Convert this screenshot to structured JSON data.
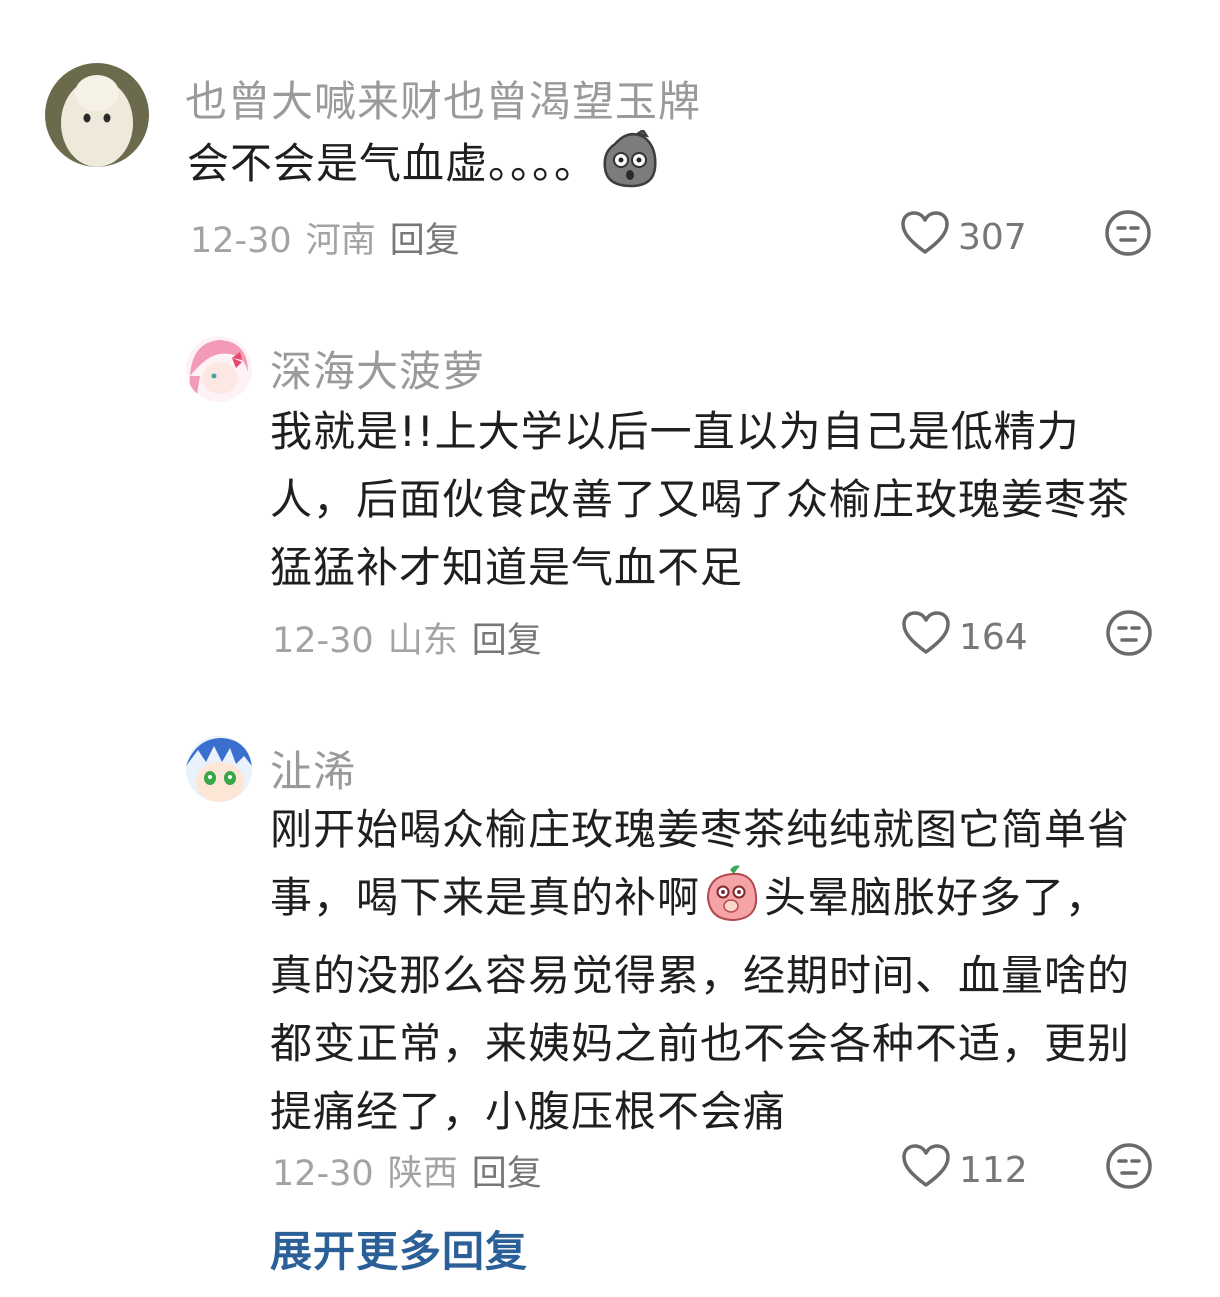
{
  "comments": [
    {
      "username": "也曾大喊来财也曾渴望玉牌",
      "text": "会不会是气血虚。。。。",
      "emoji": "stone-face-emoji",
      "date": "12-30",
      "region": "河南",
      "reply_label": "回复",
      "likes": "307"
    },
    {
      "username": "深海大菠萝",
      "text": "我就是!!上大学以后一直以为自己是低精力人，后面伙食改善了又喝了众榆庄玫瑰姜枣茶猛猛补才知道是气血不足",
      "date": "12-30",
      "region": "山东",
      "reply_label": "回复",
      "likes": "164"
    },
    {
      "username": "沚浠",
      "text_before_emoji": "刚开始喝众榆庄玫瑰姜枣茶纯纯就图它简单省事，喝下来是真的补啊",
      "emoji": "peach-emoji",
      "text_after_emoji": "头晕脑胀好多了，真的没那么容易觉得累，经期时间、血量啥的都变正常，来姨妈之前也不会各种不适，更别提痛经了，小腹压根不会痛",
      "date": "12-30",
      "region": "陕西",
      "reply_label": "回复",
      "likes": "112"
    }
  ],
  "expand_more_label": "展开更多回复",
  "colors": {
    "username": "#9a9a9a",
    "meta": "#a3a3a3",
    "link": "#2b5f97"
  }
}
